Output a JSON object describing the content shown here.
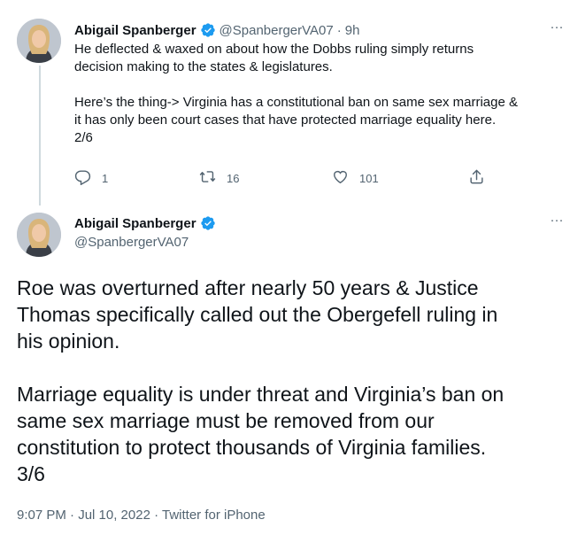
{
  "tweet1": {
    "name": "Abigail Spanberger",
    "handle": "@SpanbergerVA07",
    "separator": "·",
    "time": "9h",
    "text": "He deflected & waxed on about how the Dobbs ruling simply returns\ndecision making to the states & legislatures.\n\nHere’s the thing-> Virginia has a constitutional ban on same sex marriage &\nit has only been court cases that have protected marriage equality here.\n2/6",
    "reply_count": "1",
    "retweet_count": "16",
    "like_count": "101",
    "more": "···"
  },
  "tweet2": {
    "name": "Abigail Spanberger",
    "handle": "@SpanbergerVA07",
    "text": "Roe was overturned after nearly 50 years & Justice\nThomas specifically called out the Obergefell ruling in\nhis opinion.\n\nMarriage equality is under threat and Virginia’s ban on\nsame sex marriage must be removed from our\nconstitution to protect thousands of Virginia families.\n3/6",
    "meta": "9:07 PM · Jul 10, 2022 · Twitter for iPhone",
    "more": "···"
  },
  "colors": {
    "verified": "#1d9bf0",
    "secondary_text": "#536471",
    "primary_text": "#0f1419",
    "thread_line": "#cfd9de"
  }
}
